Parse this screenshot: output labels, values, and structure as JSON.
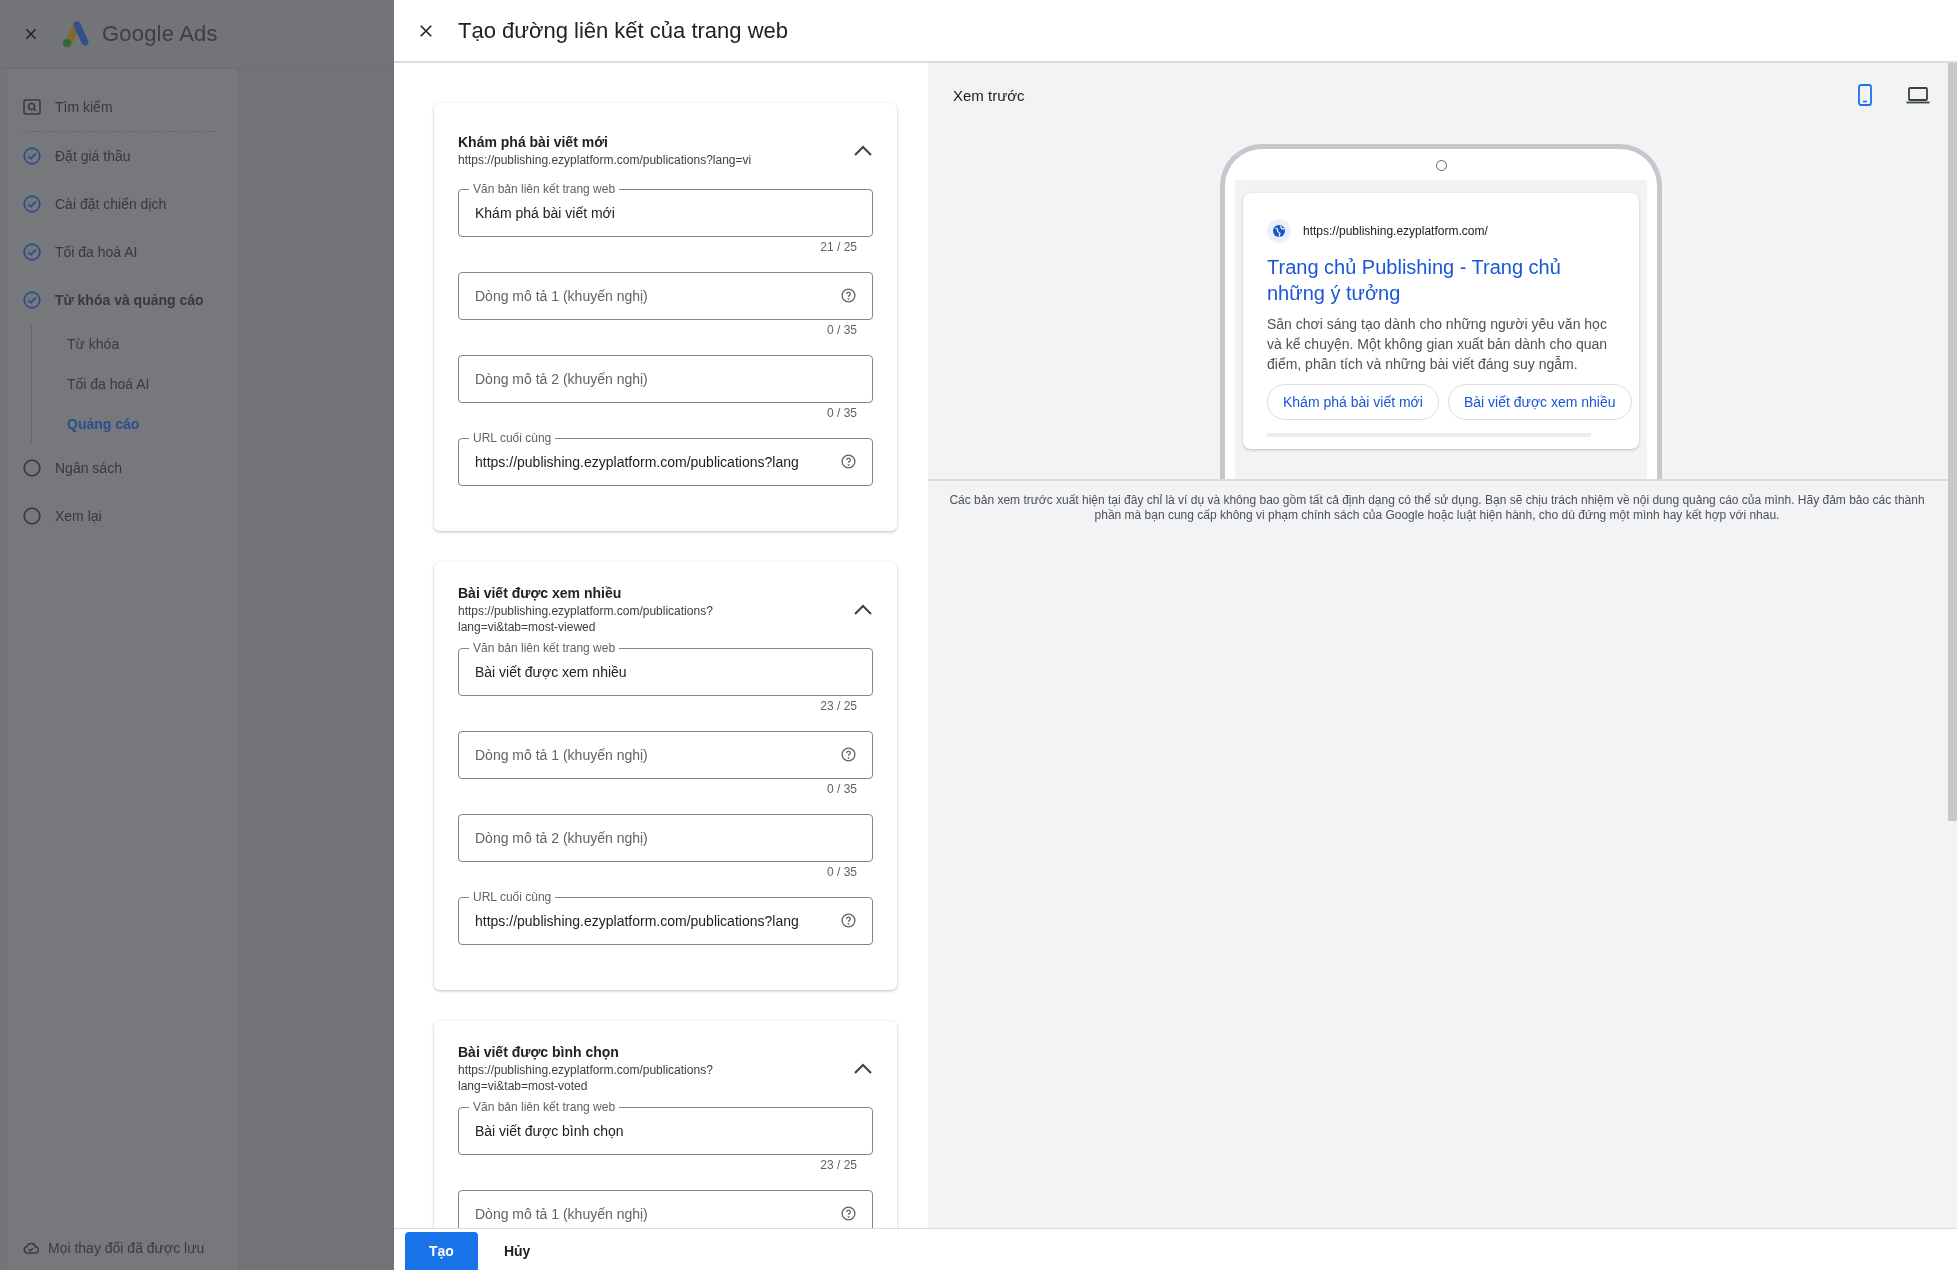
{
  "background_app": {
    "product": "Google Ads",
    "nav": [
      {
        "kind": "search",
        "label": "Tìm kiếm"
      },
      {
        "kind": "step",
        "label": "Đặt giá thầu",
        "done": true,
        "selected": false
      },
      {
        "kind": "step",
        "label": "Cài đặt chiến dịch",
        "done": true,
        "selected": false
      },
      {
        "kind": "step",
        "label": "Tối đa hoá AI",
        "done": true,
        "selected": false
      },
      {
        "kind": "step",
        "label": "Từ khóa và quảng cáo",
        "done": true,
        "selected": true,
        "children": [
          {
            "label": "Từ khóa",
            "selected": false
          },
          {
            "label": "Tối đa hoá AI",
            "selected": false
          },
          {
            "label": "Quảng cáo",
            "selected": true
          }
        ]
      },
      {
        "kind": "step",
        "label": "Ngân sách",
        "done": false,
        "selected": false
      },
      {
        "kind": "step",
        "label": "Xem lại",
        "done": false,
        "selected": false
      }
    ],
    "save_status": "Mọi thay đổi đã được lưu"
  },
  "dialog": {
    "title": "Tạo đường liên kết của trang web",
    "sitelinks": [
      {
        "title": "Khám phá bài viết mới",
        "url": "https://publishing.ezyplatform.com/publications?lang=vi",
        "expanded": true,
        "fields": [
          {
            "label": "Văn bản liên kết trang web",
            "value": "Khám phá bài viết mới",
            "counter": "21 / 25",
            "help": false
          },
          {
            "placeholder": "Dòng mô tả 1 (khuyến nghị)",
            "counter": "0 / 35",
            "help": true
          },
          {
            "placeholder": "Dòng mô tả 2 (khuyến nghị)",
            "counter": "0 / 35",
            "help": false
          },
          {
            "label": "URL cuối cùng",
            "value": "https://publishing.ezyplatform.com/publications?lang",
            "help": true
          }
        ]
      },
      {
        "title": "Bài viết được xem nhiều",
        "url": "https://publishing.ezyplatform.com/publications?lang=vi&tab=most-viewed",
        "expanded": true,
        "fields": [
          {
            "label": "Văn bản liên kết trang web",
            "value": "Bài viết được xem nhiều",
            "counter": "23 / 25",
            "help": false
          },
          {
            "placeholder": "Dòng mô tả 1 (khuyến nghị)",
            "counter": "0 / 35",
            "help": true
          },
          {
            "placeholder": "Dòng mô tả 2 (khuyến nghị)",
            "counter": "0 / 35",
            "help": false
          },
          {
            "label": "URL cuối cùng",
            "value": "https://publishing.ezyplatform.com/publications?lang",
            "help": true
          }
        ]
      },
      {
        "title": "Bài viết được bình chọn",
        "url": "https://publishing.ezyplatform.com/publications?lang=vi&tab=most-voted",
        "expanded": true,
        "fields": [
          {
            "label": "Văn bản liên kết trang web",
            "value": "Bài viết được bình chọn",
            "counter": "23 / 25",
            "help": false
          },
          {
            "placeholder": "Dòng mô tả 1 (khuyến nghị)",
            "help": true
          }
        ]
      }
    ],
    "preview": {
      "title": "Xem trước",
      "devices": [
        {
          "kind": "mobile",
          "selected": true
        },
        {
          "kind": "desktop",
          "selected": false
        }
      ],
      "ad": {
        "display_url": "https://publishing.ezyplatform.com/",
        "headline": "Trang chủ Publishing - Trang chủ những ý tưởng",
        "description": "Sân chơi sáng tạo dành cho những người yêu văn học và kể chuyện. Một không gian xuất bản dành cho quan điểm, phân tích và những bài viết đáng suy ngẫm.",
        "sitelinks": [
          "Khám phá bài viết mới",
          "Bài viết được xem nhiều"
        ]
      },
      "disclaimer": "Các bản xem trước xuất hiện tại đây chỉ là ví dụ và không bao gồm tất cả định dạng có thể sử dụng. Bạn sẽ chịu trách nhiệm về nội dung quảng cáo của mình. Hãy đảm bảo các thành phần mà bạn cung cấp không vi phạm chính sách của Google hoặc luật hiện hành, cho dù đứng một mình hay kết hợp với nhau."
    },
    "buttons": [
      {
        "label": "Tạo",
        "kind": "primary"
      },
      {
        "label": "Hủy",
        "kind": "text"
      }
    ]
  }
}
